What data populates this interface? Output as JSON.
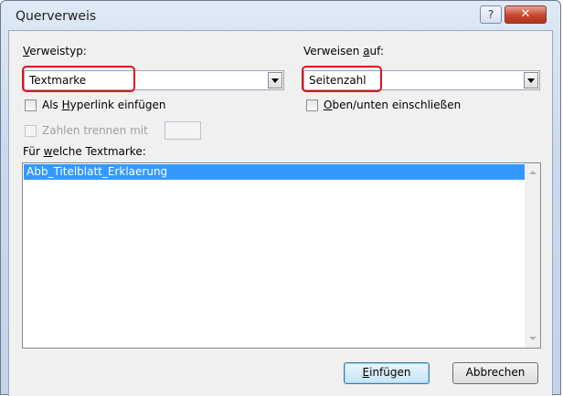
{
  "window": {
    "title": "Querverweis"
  },
  "titlebar": {
    "help_glyph": "?",
    "close_glyph": "✕"
  },
  "reference_type": {
    "label_mnemonic": "V",
    "label_rest": "erweistyp:",
    "value": "Textmarke"
  },
  "refer_to": {
    "label_pre": "Verweisen ",
    "label_mnemonic": "a",
    "label_rest": "uf:",
    "value": "Seitenzahl"
  },
  "hyperlink": {
    "label_pre": "Als ",
    "label_mnemonic": "H",
    "label_rest": "yperlink einfügen",
    "checked": false
  },
  "above_below": {
    "label_mnemonic": "O",
    "label_rest": "ben/unten einschließen",
    "checked": false
  },
  "separate_numbers": {
    "label": "Zahlen trennen mit",
    "enabled": false,
    "value": ""
  },
  "bookmark_list": {
    "label_pre": "Für ",
    "label_mnemonic": "w",
    "label_rest": "elche Textmarke:",
    "items": [
      "Abb_Titelblatt_Erklaerung"
    ]
  },
  "buttons": {
    "insert_mnemonic": "E",
    "insert_rest": "infügen",
    "cancel": "Abbrechen"
  },
  "colors": {
    "highlight_red": "#e0121c",
    "selection_blue": "#3399ff",
    "close_red": "#c7452f"
  }
}
